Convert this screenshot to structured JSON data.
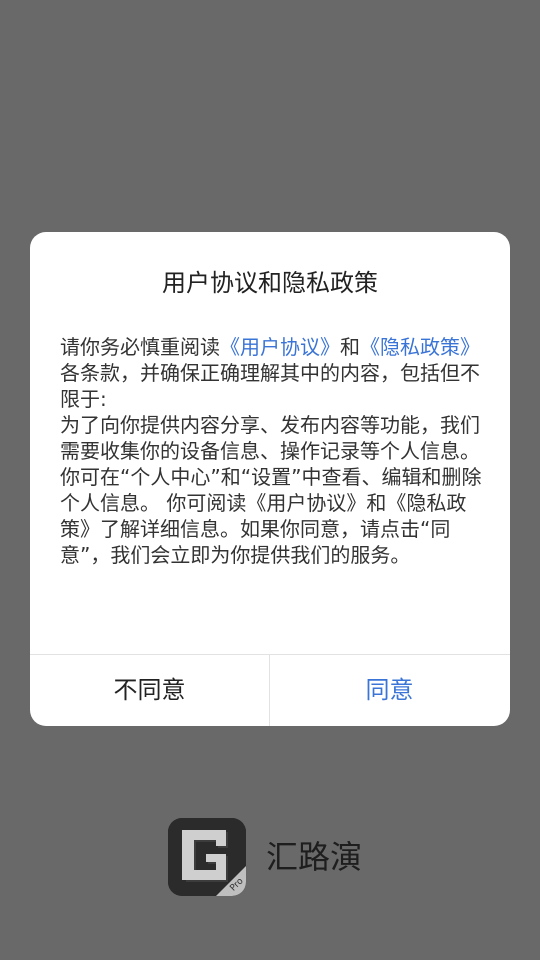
{
  "dialog": {
    "title": "用户协议和隐私政策",
    "body": {
      "p1_a": "请你务必慎重阅读",
      "p1_link1": "《用户协议》",
      "p1_b": "和",
      "p1_link2": "《隐私政策》",
      "p1_c": "各条款，并确保正确理解其中的内容，包括但不限于:\n为了向你提供内容分享、发布内容等功能，我们需要收集你的设备信息、操作记录等个人信息。\n你可在“个人中心”和“设置”中查看、编辑和删除个人信息。 你可阅读《用户协议》和《隐私政策》了解详细信息。如果你同意，请点击“同意”，我们会立即为你提供我们的服务。"
    },
    "disagree_label": "不同意",
    "agree_label": "同意"
  },
  "brand": {
    "name": "汇路演",
    "logo_badge": "Pro",
    "logo_icon": "g-logo-icon"
  },
  "colors": {
    "overlay": "#696969",
    "link": "#3a74d6",
    "dialog_bg": "#ffffff"
  }
}
